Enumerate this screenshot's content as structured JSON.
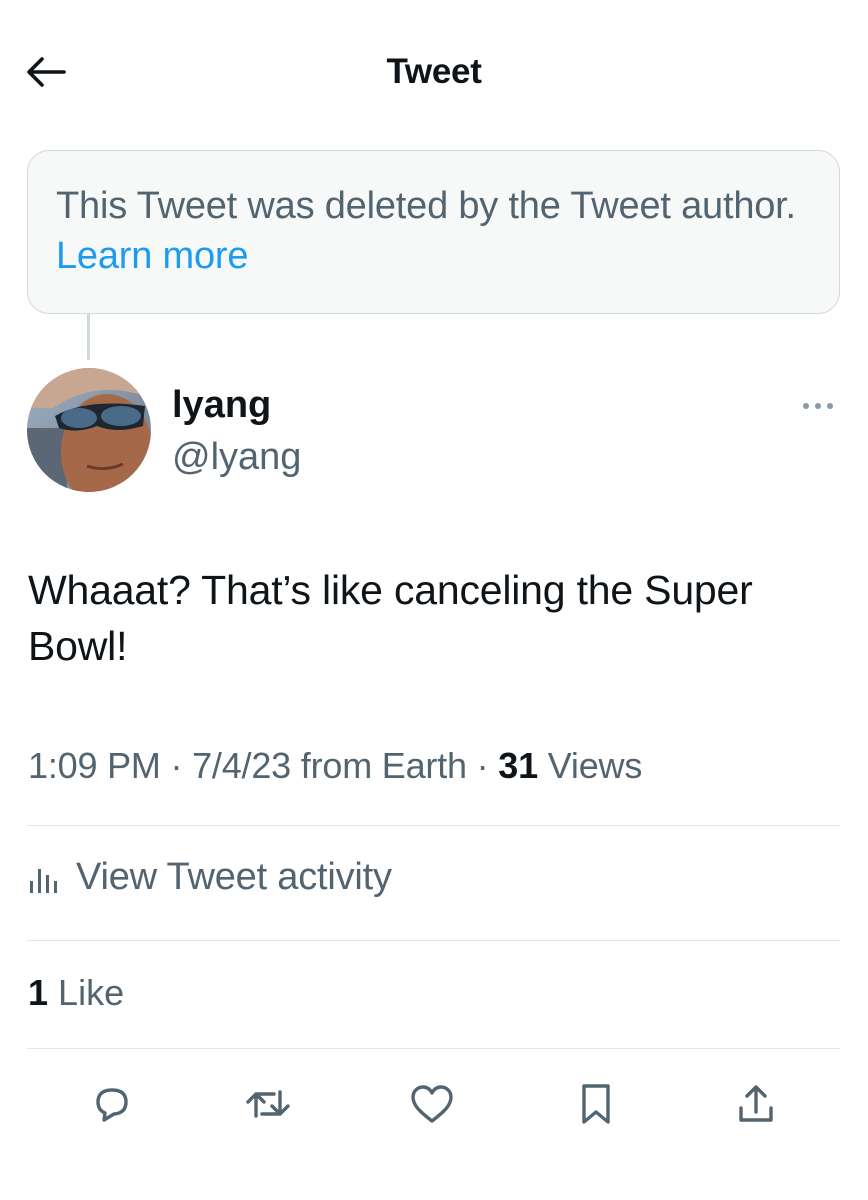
{
  "header": {
    "title": "Tweet",
    "back_icon": "arrow-left-icon"
  },
  "deleted_notice": {
    "text": "This Tweet was deleted by the Tweet author.",
    "link": "Learn more"
  },
  "author": {
    "display_name": "lyang",
    "handle": "@lyang"
  },
  "tweet": {
    "text": "Whaaat? That’s like canceling the Super Bowl!"
  },
  "meta": {
    "time": "1:09 PM",
    "date": "7/4/23",
    "source": "from Earth",
    "separator": "·",
    "views_count": "31",
    "views_label": "Views"
  },
  "activity": {
    "label": "View Tweet activity",
    "icon": "bar-chart-icon"
  },
  "likes": {
    "count": "1",
    "label": "Like"
  },
  "actions": [
    "reply-icon",
    "retweet-icon",
    "like-icon",
    "bookmark-icon",
    "share-icon"
  ],
  "colors": {
    "text": "#0f1419",
    "secondary": "#536471",
    "link": "#1d9bf0",
    "border": "#cfd9de"
  }
}
